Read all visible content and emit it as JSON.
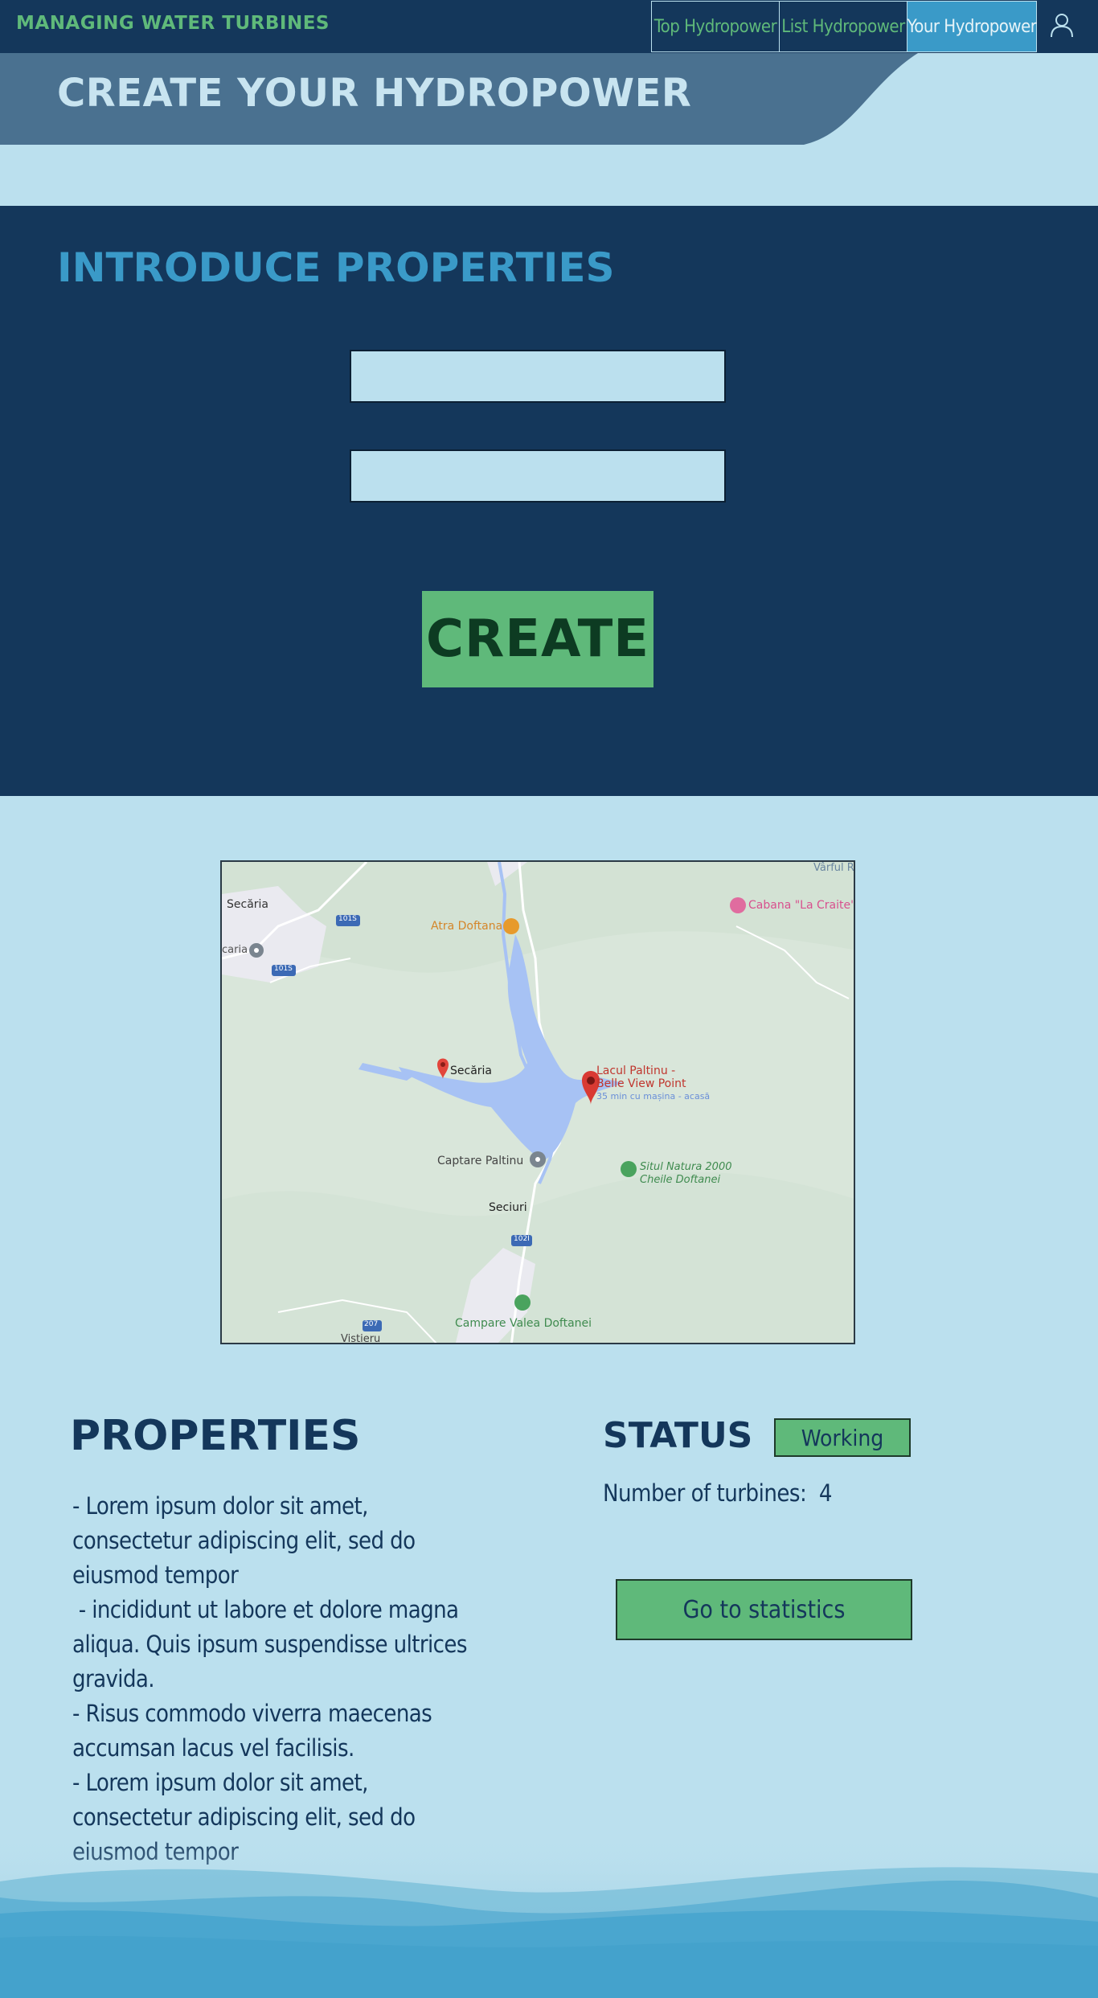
{
  "nav": {
    "brand": "MANAGING WATER TURBINES",
    "tabs": [
      "Top Hydropower",
      "List Hydropower",
      "Your Hydropower"
    ],
    "active_tab": "Your Hydropower"
  },
  "hero": {
    "title": "CREATE YOUR HYDROPOWER"
  },
  "form": {
    "title": "INTRODUCE PROPERTIES",
    "field1_value": "",
    "field2_value": "",
    "create_label": "CREATE"
  },
  "map": {
    "labels": {
      "secaria_nw": "Secăria",
      "caria_w": "caria",
      "road_101s_a": "101S",
      "road_101s_b": "101S",
      "atra": "Atra Doftana",
      "cabana": "Cabana \"La Craite\"",
      "varful": "Vârful R",
      "secaria_pin": "Secăria",
      "lacul_1": "Lacul Paltinu -",
      "lacul_2": "Belle View Point",
      "lacul_3": "35 min cu mașina - acasă",
      "captare": "Captare Paltinu",
      "situl_1": "Situl Natura 2000",
      "situl_2": "Cheile Doftanei",
      "seciuri": "Seciuri",
      "road_102i": "102I",
      "road_207": "207",
      "campare": "Campare Valea Doftanei",
      "vistieru": "Vistieru"
    }
  },
  "properties": {
    "title": "PROPERTIES",
    "lines": [
      "- Lorem ipsum dolor sit amet, consectetur adipiscing elit, sed do eiusmod tempor",
      " - incididunt ut labore et dolore magna aliqua. Quis ipsum suspendisse ultrices gravida.",
      "- Risus commodo viverra maecenas accumsan lacus vel facilisis.",
      "- Lorem ipsum dolor sit amet, consectetur adipiscing elit, sed do eiusmod tempor"
    ]
  },
  "status": {
    "title": "STATUS",
    "value": "Working",
    "turbines_label": "Number of turbines:",
    "turbines_count": "4",
    "stats_button": "Go to statistics"
  },
  "colors": {
    "navy": "#14375b",
    "light_blue": "#bbe0ee",
    "accent_blue": "#3a9ac8",
    "green": "#5fb97a"
  }
}
